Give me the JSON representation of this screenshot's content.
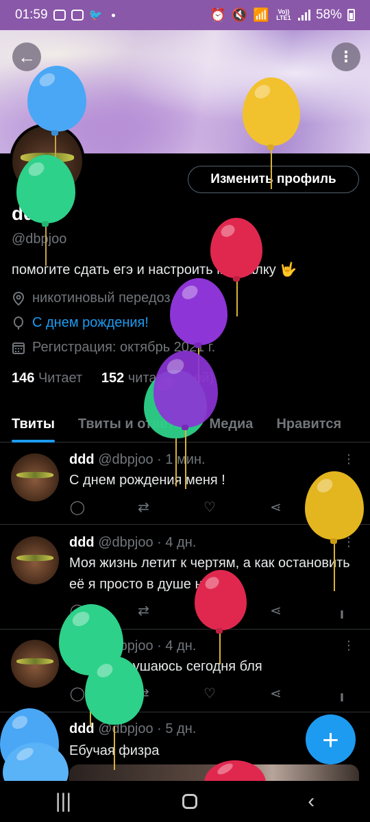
{
  "status_bar": {
    "time": "01:59",
    "volte": "Vo)) LTE1",
    "battery": "58%"
  },
  "profile": {
    "display_name": "ddd",
    "handle": "@dbpjoo",
    "bio": "помогите сдать егэ и настроить менталку 🤟",
    "location": "никотиновый передоз",
    "birthday": "С днем рождения!",
    "joined": "Регистрация: октябрь 2021 г.",
    "following_count": "146",
    "following_label": "Читает",
    "followers_count": "152",
    "followers_label": "читателя(-ей)",
    "edit_button": "Изменить профиль"
  },
  "tabs": [
    "Твиты",
    "Твиты и ответы",
    "Медиа",
    "Нравится"
  ],
  "tweets": [
    {
      "name": "ddd",
      "handle": "@dbpjoo",
      "time": "· 1 мин.",
      "text": "С днем рождения меня !"
    },
    {
      "name": "ddd",
      "handle": "@dbpjoo",
      "time": "· 4 дн.",
      "text": "Моя жизнь летит к чертям, а как остановить её я просто в душе не ебу"
    },
    {
      "name": "ddd",
      "handle": "@dbpjoo",
      "time": "· 4 дн.",
      "text": "Саморазрушаюсь сегодня бля"
    },
    {
      "name": "ddd",
      "handle": "@dbpjoo",
      "time": "· 5 дн.",
      "text": "Ебучая физра"
    }
  ],
  "icons": {
    "back": "arrow-left-icon",
    "more": "more-vertical-icon",
    "compose": "plus-icon",
    "reply": "reply-icon",
    "retweet": "retweet-icon",
    "like": "heart-icon",
    "share": "share-icon",
    "stats": "stats-icon"
  },
  "colors": {
    "accent": "#1d9bf0",
    "status_bar": "#8a58a8",
    "balloon_blue": "#4aa7f5",
    "balloon_yellow": "#f2c12e",
    "balloon_green": "#2ed18a",
    "balloon_red": "#e0284f",
    "balloon_purple": "#8d35d6"
  }
}
